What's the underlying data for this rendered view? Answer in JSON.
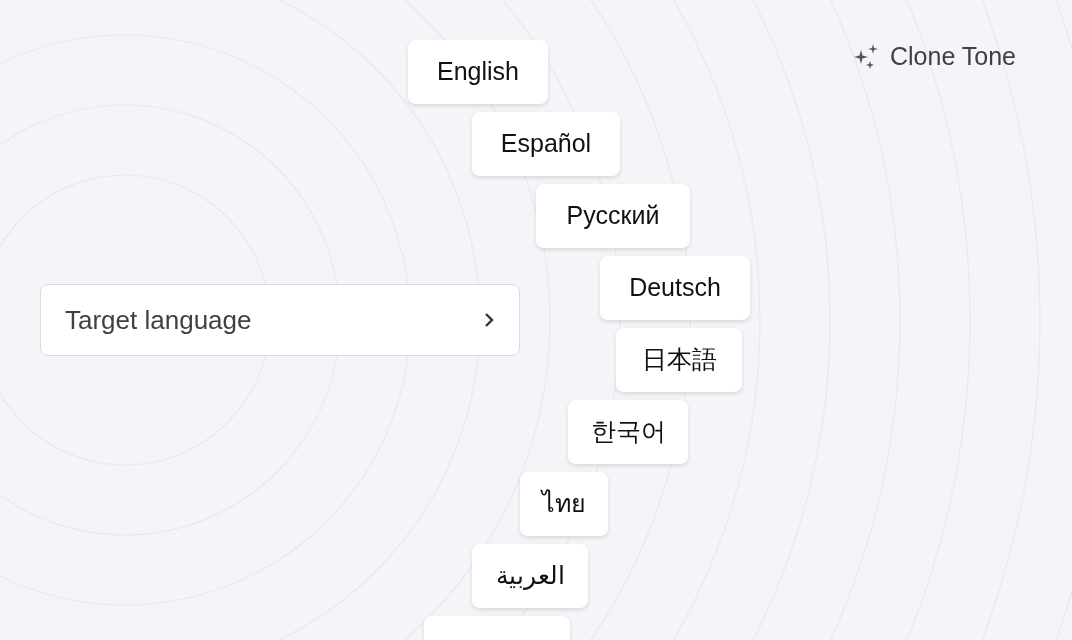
{
  "header": {
    "action": "Clone Tone"
  },
  "selector": {
    "label": "Target language"
  },
  "languages": [
    {
      "kind": "chip",
      "label": "English"
    },
    {
      "kind": "chip",
      "label": "Español"
    },
    {
      "kind": "chip",
      "label": "Русский"
    },
    {
      "kind": "chip",
      "label": "Deutsch"
    },
    {
      "kind": "chip",
      "label": "日本語"
    },
    {
      "kind": "chip",
      "label": "한국어"
    },
    {
      "kind": "chip",
      "label": "ไทย"
    },
    {
      "kind": "chip",
      "label": "العربية"
    },
    {
      "kind": "cut"
    }
  ]
}
